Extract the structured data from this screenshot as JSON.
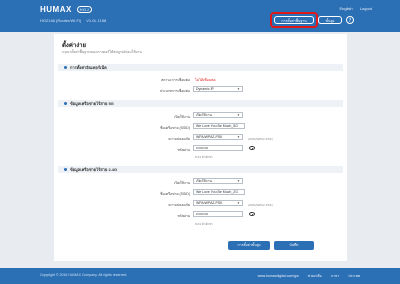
{
  "header": {
    "brand": "HUMAX",
    "brand_tag": "HGJ",
    "model": "HG2146 (Router/Wi-Fi)",
    "version": "V1.0L 1158",
    "top_links": [
      "English",
      "Logout"
    ],
    "btn_connect": "การตั้งค่าพื้นฐาน",
    "btn_advanced": "ขั้นสูง",
    "help": "?"
  },
  "page": {
    "title": "ตั้งค่าง่าย",
    "subtitle": "กรุณาตั้งค่าพื้นฐานของเราเตอร์ให้สมบูรณ์ก่อนใช้งาน"
  },
  "internet": {
    "title": "การตั้งค่าอินเทอร์เน็ต",
    "status_label": "สถานะการเชื่อมต่อ",
    "status_value": "ไม่ได้เชื่อมต่อ",
    "type_label": "ประเภทการเชื่อมต่อ",
    "type_value": "Dynamic IP"
  },
  "wifi5": {
    "title": "ข้อมูลเครือข่ายไร้สาย 5G",
    "enable_label": "เปิดใช้งาน",
    "enable_value": "เปิดใช้งาน",
    "ssid_label": "ชื่อเครือข่าย (SSID)",
    "ssid_value": "We Love You Be Much_5G",
    "security_label": "ความปลอดภัย",
    "security_value": "WPA/WPA2-PSK",
    "security_hint": "(WPA/WPA2-PSK)",
    "password_label": "รหัสผ่าน",
    "password_value": "••••••••••",
    "password_hint": "8-63 ตัวอักษร"
  },
  "wifi24": {
    "title": "ข้อมูลเครือข่ายไร้สาย 2.4G",
    "enable_label": "เปิดใช้งาน",
    "enable_value": "เปิดใช้งาน",
    "ssid_label": "ชื่อเครือข่าย (SSID)",
    "ssid_value": "We Love You Be Much_2G",
    "security_label": "ความปลอดภัย",
    "security_value": "WPA/WPA2-PSK",
    "security_hint": "(WPA/WPA2-PSK)",
    "password_label": "รหัสผ่าน",
    "password_value": "••••••••••",
    "password_hint": "8-63 ตัวอักษร"
  },
  "buttons": {
    "apply": "การตั้งค่าขั้นสูง",
    "save": "บันทึก"
  },
  "footer": {
    "copyright": "Copyright © 2016 HUMAX Company. All rights reserved.",
    "links": [
      "www.humaxdigital.com/gw",
      "ช่วยเหลือ",
      "ภาษา",
      "ประเทศ"
    ]
  },
  "colors": {
    "primary": "#2b6fb5",
    "alert": "#e01818",
    "highlight": "#e01818"
  }
}
